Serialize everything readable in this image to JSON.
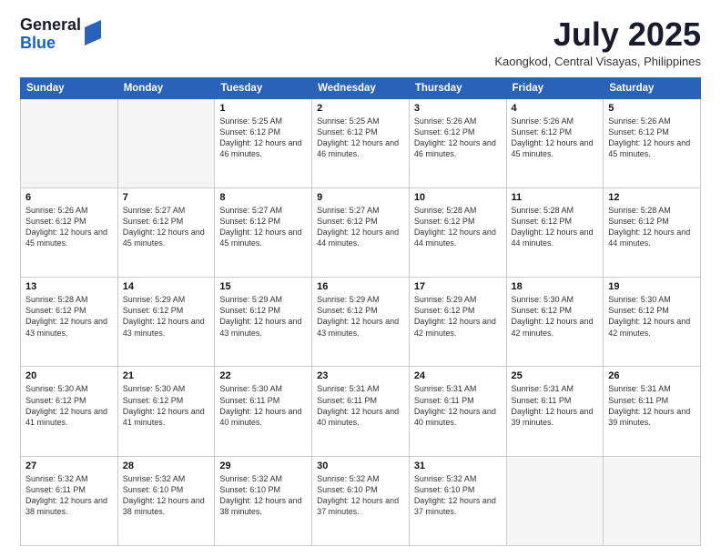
{
  "logo": {
    "general": "General",
    "blue": "Blue"
  },
  "header": {
    "month": "July 2025",
    "location": "Kaongkod, Central Visayas, Philippines"
  },
  "weekdays": [
    "Sunday",
    "Monday",
    "Tuesday",
    "Wednesday",
    "Thursday",
    "Friday",
    "Saturday"
  ],
  "weeks": [
    [
      {
        "day": "",
        "empty": true
      },
      {
        "day": "",
        "empty": true
      },
      {
        "day": "1",
        "sunrise": "5:25 AM",
        "sunset": "6:12 PM",
        "daylight": "12 hours and 46 minutes."
      },
      {
        "day": "2",
        "sunrise": "5:25 AM",
        "sunset": "6:12 PM",
        "daylight": "12 hours and 46 minutes."
      },
      {
        "day": "3",
        "sunrise": "5:26 AM",
        "sunset": "6:12 PM",
        "daylight": "12 hours and 46 minutes."
      },
      {
        "day": "4",
        "sunrise": "5:26 AM",
        "sunset": "6:12 PM",
        "daylight": "12 hours and 45 minutes."
      },
      {
        "day": "5",
        "sunrise": "5:26 AM",
        "sunset": "6:12 PM",
        "daylight": "12 hours and 45 minutes."
      }
    ],
    [
      {
        "day": "6",
        "sunrise": "5:26 AM",
        "sunset": "6:12 PM",
        "daylight": "12 hours and 45 minutes."
      },
      {
        "day": "7",
        "sunrise": "5:27 AM",
        "sunset": "6:12 PM",
        "daylight": "12 hours and 45 minutes."
      },
      {
        "day": "8",
        "sunrise": "5:27 AM",
        "sunset": "6:12 PM",
        "daylight": "12 hours and 45 minutes."
      },
      {
        "day": "9",
        "sunrise": "5:27 AM",
        "sunset": "6:12 PM",
        "daylight": "12 hours and 44 minutes."
      },
      {
        "day": "10",
        "sunrise": "5:28 AM",
        "sunset": "6:12 PM",
        "daylight": "12 hours and 44 minutes."
      },
      {
        "day": "11",
        "sunrise": "5:28 AM",
        "sunset": "6:12 PM",
        "daylight": "12 hours and 44 minutes."
      },
      {
        "day": "12",
        "sunrise": "5:28 AM",
        "sunset": "6:12 PM",
        "daylight": "12 hours and 44 minutes."
      }
    ],
    [
      {
        "day": "13",
        "sunrise": "5:28 AM",
        "sunset": "6:12 PM",
        "daylight": "12 hours and 43 minutes."
      },
      {
        "day": "14",
        "sunrise": "5:29 AM",
        "sunset": "6:12 PM",
        "daylight": "12 hours and 43 minutes."
      },
      {
        "day": "15",
        "sunrise": "5:29 AM",
        "sunset": "6:12 PM",
        "daylight": "12 hours and 43 minutes."
      },
      {
        "day": "16",
        "sunrise": "5:29 AM",
        "sunset": "6:12 PM",
        "daylight": "12 hours and 43 minutes."
      },
      {
        "day": "17",
        "sunrise": "5:29 AM",
        "sunset": "6:12 PM",
        "daylight": "12 hours and 42 minutes."
      },
      {
        "day": "18",
        "sunrise": "5:30 AM",
        "sunset": "6:12 PM",
        "daylight": "12 hours and 42 minutes."
      },
      {
        "day": "19",
        "sunrise": "5:30 AM",
        "sunset": "6:12 PM",
        "daylight": "12 hours and 42 minutes."
      }
    ],
    [
      {
        "day": "20",
        "sunrise": "5:30 AM",
        "sunset": "6:12 PM",
        "daylight": "12 hours and 41 minutes."
      },
      {
        "day": "21",
        "sunrise": "5:30 AM",
        "sunset": "6:12 PM",
        "daylight": "12 hours and 41 minutes."
      },
      {
        "day": "22",
        "sunrise": "5:30 AM",
        "sunset": "6:11 PM",
        "daylight": "12 hours and 40 minutes."
      },
      {
        "day": "23",
        "sunrise": "5:31 AM",
        "sunset": "6:11 PM",
        "daylight": "12 hours and 40 minutes."
      },
      {
        "day": "24",
        "sunrise": "5:31 AM",
        "sunset": "6:11 PM",
        "daylight": "12 hours and 40 minutes."
      },
      {
        "day": "25",
        "sunrise": "5:31 AM",
        "sunset": "6:11 PM",
        "daylight": "12 hours and 39 minutes."
      },
      {
        "day": "26",
        "sunrise": "5:31 AM",
        "sunset": "6:11 PM",
        "daylight": "12 hours and 39 minutes."
      }
    ],
    [
      {
        "day": "27",
        "sunrise": "5:32 AM",
        "sunset": "6:11 PM",
        "daylight": "12 hours and 38 minutes."
      },
      {
        "day": "28",
        "sunrise": "5:32 AM",
        "sunset": "6:10 PM",
        "daylight": "12 hours and 38 minutes."
      },
      {
        "day": "29",
        "sunrise": "5:32 AM",
        "sunset": "6:10 PM",
        "daylight": "12 hours and 38 minutes."
      },
      {
        "day": "30",
        "sunrise": "5:32 AM",
        "sunset": "6:10 PM",
        "daylight": "12 hours and 37 minutes."
      },
      {
        "day": "31",
        "sunrise": "5:32 AM",
        "sunset": "6:10 PM",
        "daylight": "12 hours and 37 minutes."
      },
      {
        "day": "",
        "empty": true
      },
      {
        "day": "",
        "empty": true
      }
    ]
  ]
}
